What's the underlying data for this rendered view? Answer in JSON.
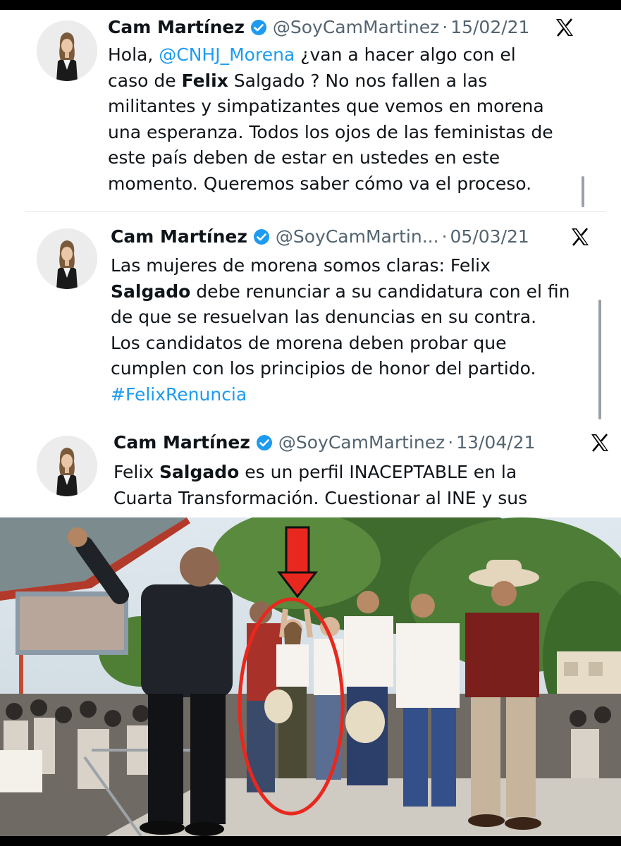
{
  "tweets": [
    {
      "author_name": "Cam Martínez",
      "handle": "@SoyCamMartinez",
      "separator": "·",
      "date": "15/02/21",
      "verified_icon": "verified-badge-icon",
      "platform_icon": "x-logo-icon",
      "lines": [
        {
          "parts": [
            {
              "t": "Hola, "
            },
            {
              "t": "@CNHJ_Morena",
              "style": "link"
            },
            {
              "t": " ¿van a hacer algo con el"
            }
          ]
        },
        {
          "parts": [
            {
              "t": "caso de "
            },
            {
              "t": "Felix",
              "style": "bold"
            },
            {
              "t": " Salgado ? No nos fallen a las"
            }
          ]
        },
        {
          "parts": [
            {
              "t": "militantes y simpatizantes que vemos en morena"
            }
          ]
        },
        {
          "parts": [
            {
              "t": "una esperanza. Todos los ojos de las feministas de"
            }
          ]
        },
        {
          "parts": [
            {
              "t": "este país deben de estar en ustedes en este"
            }
          ]
        },
        {
          "parts": [
            {
              "t": "momento. Queremos saber cómo va el proceso."
            }
          ]
        }
      ]
    },
    {
      "author_name": "Cam Martínez",
      "handle": "@SoyCamMartin...",
      "separator": "·",
      "date": "05/03/21",
      "verified_icon": "verified-badge-icon",
      "platform_icon": "x-logo-icon",
      "lines": [
        {
          "parts": [
            {
              "t": "Las mujeres de morena somos claras: Felix"
            }
          ]
        },
        {
          "parts": [
            {
              "t": "Salgado",
              "style": "bold"
            },
            {
              "t": " debe renunciar a su candidatura con el fin"
            }
          ]
        },
        {
          "parts": [
            {
              "t": "de que se resuelvan las denuncias en su contra."
            }
          ]
        },
        {
          "parts": [
            {
              "t": "Los candidatos de morena deben probar que"
            }
          ]
        },
        {
          "parts": [
            {
              "t": "cumplen con los principios de honor del partido."
            }
          ]
        },
        {
          "parts": [
            {
              "t": "#FelixRenuncia",
              "style": "link"
            }
          ]
        }
      ]
    },
    {
      "author_name": "Cam Martínez",
      "handle": "@SoyCamMartinez",
      "separator": "·",
      "date": "13/04/21",
      "verified_icon": "verified-badge-icon",
      "platform_icon": "x-logo-icon",
      "lines": [
        {
          "parts": [
            {
              "t": "Felix "
            },
            {
              "t": "Salgado",
              "style": "bold"
            },
            {
              "t": " es un perfil INACEPTABLE en la"
            }
          ]
        },
        {
          "parts": [
            {
              "t": "Cuarta Transformación. Cuestionar al INE y sus"
            }
          ]
        }
      ]
    }
  ],
  "colors": {
    "text": "#0f1419",
    "secondary": "#536471",
    "link": "#1d9bf0",
    "verified": "#1d9bf0",
    "highlight_circle": "#e8281e"
  },
  "photo": {
    "annotation_icons": [
      "red-down-arrow-icon",
      "red-ellipse-highlight"
    ]
  }
}
